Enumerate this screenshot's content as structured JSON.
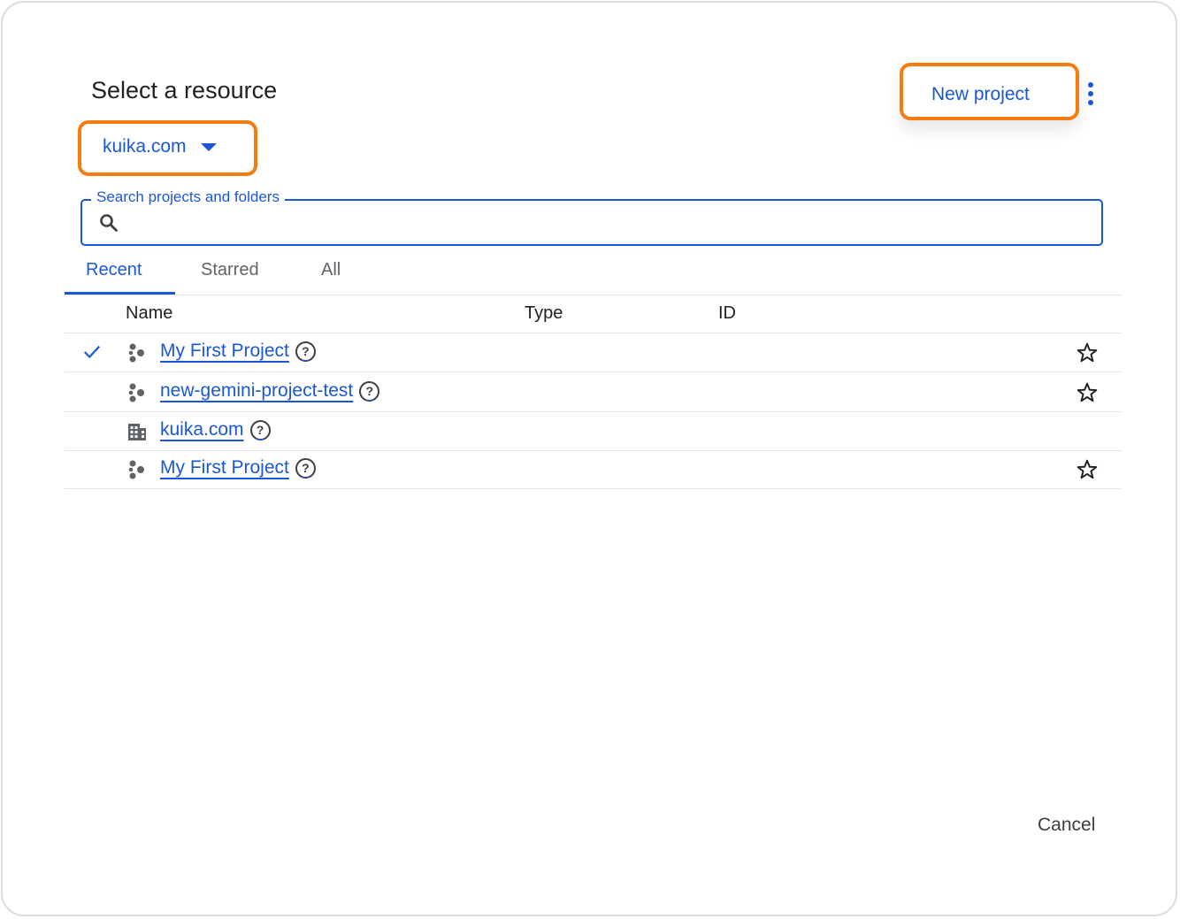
{
  "dialog": {
    "title": "Select a resource",
    "org_selector": {
      "label": "kuika.com",
      "icon": "caret-down-icon"
    },
    "new_project_label": "New project",
    "more_icon": "more-vert-icon",
    "search": {
      "label": "Search projects and folders",
      "value": "",
      "icon": "search-icon"
    },
    "tabs": [
      {
        "label": "Recent",
        "active": true
      },
      {
        "label": "Starred",
        "active": false
      },
      {
        "label": "All",
        "active": false
      }
    ],
    "columns": {
      "name": "Name",
      "type": "Type",
      "id": "ID"
    },
    "rows": [
      {
        "name": "My First Project",
        "icon": "project-icon",
        "selected": true,
        "starrable": true
      },
      {
        "name": "new-gemini-project-test",
        "icon": "project-icon",
        "selected": false,
        "starrable": true
      },
      {
        "name": "kuika.com",
        "icon": "organization-icon",
        "selected": false,
        "starrable": false
      },
      {
        "name": "My First Project",
        "icon": "project-icon",
        "selected": false,
        "starrable": true
      }
    ],
    "help_glyph": "?",
    "cancel_label": "Cancel"
  },
  "colors": {
    "accent": "#1a57d6",
    "highlight": "#f57c0f",
    "text": "#202124",
    "icon": "#5f6368"
  }
}
